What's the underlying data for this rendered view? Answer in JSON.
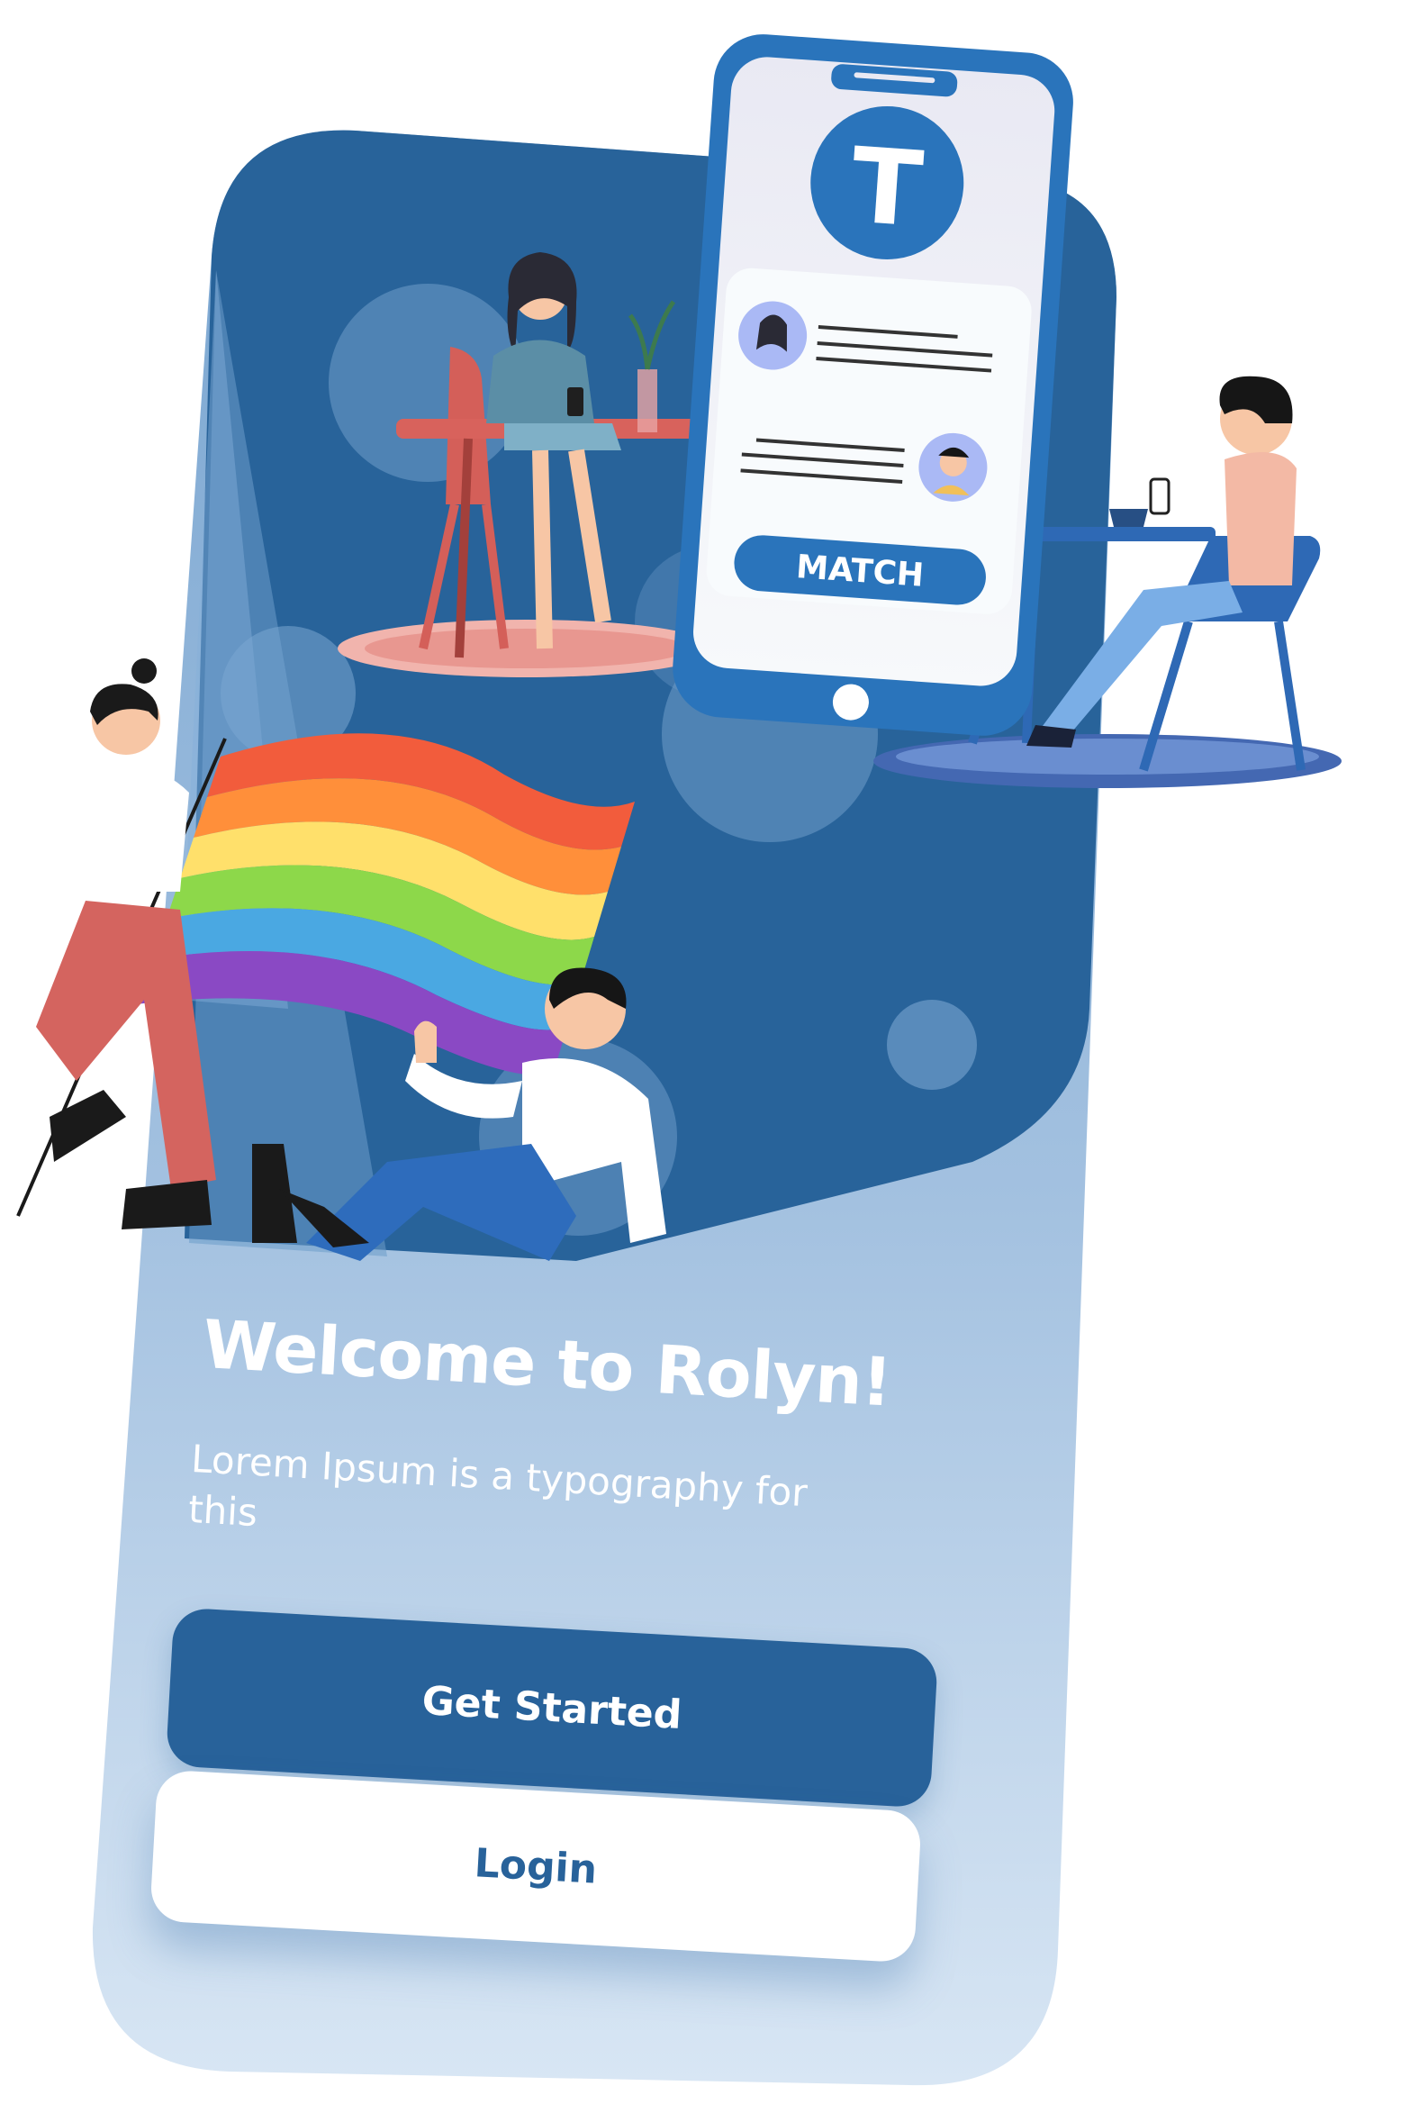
{
  "phone_screen": {
    "logo_letter": "T",
    "match_button_label": "MATCH"
  },
  "welcome": {
    "title": "Welcome to Rolyn!",
    "subtitle": "Lorem Ipsum is a typography for this"
  },
  "actions": {
    "get_started_label": "Get Started",
    "login_label": "Login"
  },
  "colors": {
    "primary": "#28629a",
    "phone_body": "#2a74bb",
    "background_light": "#c9dcef",
    "white": "#ffffff"
  },
  "illustrations": [
    "woman-at-cafe-table",
    "man-at-cafe-table",
    "person-holding-rainbow-flag",
    "seated-man-waving",
    "dating-app-phone"
  ]
}
